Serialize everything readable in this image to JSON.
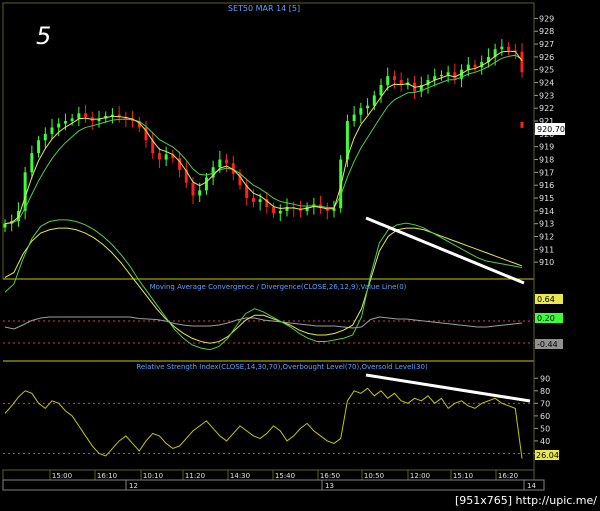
{
  "chart_data": {
    "type": "line",
    "title": "SET50 MAR 14   [5]",
    "annotation_big": "5",
    "watermark": "[951x765] http://upic.me/",
    "colors": {
      "up_candle": "#3cff3c",
      "down_candle": "#ff2020",
      "ma_fast": "#e8e850",
      "ma_slow": "#4ad04a",
      "indicator_line": "#9aa0a0",
      "hline": "#c8c800",
      "dotted_level": "#d04040",
      "axis_text": "#e0e0e0",
      "title_text": "#5aa0ff"
    },
    "price_panel": {
      "ylim": [
        909,
        929.5
      ],
      "yticks": [
        "929",
        "928",
        "927",
        "926",
        "925",
        "924",
        "923",
        "922",
        "921",
        "920",
        "919",
        "918",
        "917",
        "916",
        "915",
        "914",
        "913",
        "912",
        "911",
        "910"
      ],
      "last_price_label": "920.70",
      "last_price": 920.7,
      "closes": [
        913.0,
        913.2,
        914.0,
        917.0,
        918.5,
        919.5,
        920.0,
        920.5,
        920.8,
        921.0,
        921.2,
        921.6,
        921.3,
        921.0,
        921.2,
        921.4,
        921.5,
        921.3,
        921.2,
        921.0,
        920.5,
        919.5,
        918.5,
        918.0,
        918.4,
        918.1,
        917.2,
        916.2,
        915.2,
        915.6,
        916.6,
        917.4,
        918.0,
        917.7,
        916.9,
        916.0,
        915.0,
        914.7,
        914.9,
        914.3,
        913.8,
        914.0,
        914.3,
        914.2,
        914.0,
        914.3,
        914.5,
        914.2,
        914.0,
        914.2,
        918.0,
        921.0,
        921.5,
        922.0,
        922.2,
        923.0,
        923.8,
        924.5,
        924.2,
        923.8,
        924.0,
        923.3,
        923.8,
        924.2,
        924.5,
        924.6,
        924.8,
        924.3,
        925.0,
        925.4,
        925.2,
        925.6,
        926.0,
        926.6,
        926.8,
        926.5,
        926.4,
        924.8
      ]
    },
    "macd_panel": {
      "title": "Moving Average Convergence / Divergence(CLOSE,26,12,9),Value Line(0)",
      "ylim": [
        -0.9,
        0.9
      ],
      "value_labels": [
        "0.64",
        "0.20",
        "-0.44"
      ],
      "macd": [
        -0.1,
        0.0,
        0.3,
        0.55,
        0.7,
        0.76,
        0.78,
        0.78,
        0.76,
        0.72,
        0.66,
        0.58,
        0.48,
        0.36,
        0.22,
        0.05,
        -0.1,
        -0.25,
        -0.4,
        -0.55,
        -0.66,
        -0.74,
        -0.78,
        -0.8,
        -0.76,
        -0.66,
        -0.5,
        -0.36,
        -0.3,
        -0.34,
        -0.4,
        -0.46,
        -0.52,
        -0.6,
        -0.66,
        -0.7,
        -0.7,
        -0.68,
        -0.66,
        -0.62,
        -0.4,
        0.1,
        0.5,
        0.66,
        0.72,
        0.74,
        0.72,
        0.68,
        0.62,
        0.56,
        0.5,
        0.44,
        0.38,
        0.32,
        0.28,
        0.26,
        0.24,
        0.22,
        0.2
      ],
      "signal": [
        0.08,
        0.14,
        0.36,
        0.52,
        0.62,
        0.66,
        0.68,
        0.68,
        0.66,
        0.62,
        0.56,
        0.48,
        0.38,
        0.26,
        0.12,
        -0.02,
        -0.16,
        -0.3,
        -0.42,
        -0.52,
        -0.6,
        -0.66,
        -0.7,
        -0.72,
        -0.7,
        -0.64,
        -0.54,
        -0.44,
        -0.38,
        -0.38,
        -0.42,
        -0.46,
        -0.5,
        -0.56,
        -0.6,
        -0.62,
        -0.62,
        -0.6,
        -0.56,
        -0.5,
        -0.3,
        0.05,
        0.4,
        0.58,
        0.66,
        0.68,
        0.68,
        0.66,
        0.62,
        0.58,
        0.54,
        0.5,
        0.46,
        0.42,
        0.38,
        0.34,
        0.3,
        0.26,
        0.22
      ],
      "hist": [
        -0.1,
        -0.14,
        -0.06,
        0.03,
        0.08,
        0.1,
        0.1,
        0.1,
        0.1,
        0.1,
        0.1,
        0.1,
        0.1,
        0.1,
        0.1,
        0.07,
        0.06,
        0.05,
        0.02,
        -0.03,
        -0.06,
        -0.08,
        -0.08,
        -0.08,
        -0.06,
        -0.02,
        0.04,
        0.08,
        0.08,
        0.04,
        0.02,
        0.0,
        -0.02,
        -0.04,
        -0.06,
        -0.08,
        -0.08,
        -0.08,
        -0.1,
        -0.12,
        -0.1,
        0.05,
        0.1,
        0.08,
        0.06,
        0.06,
        0.04,
        0.02,
        0.0,
        -0.02,
        -0.04,
        -0.06,
        -0.08,
        -0.1,
        -0.1,
        -0.08,
        -0.06,
        -0.04,
        -0.02
      ],
      "dotted_levels": [
        0.2,
        -0.44
      ]
    },
    "rsi_panel": {
      "title": "Relative Strength Index(CLOSE,14,30,70),Overbought Level(70),Oversold Level(30)",
      "ylim": [
        20,
        95
      ],
      "yticks": [
        "90",
        "80",
        "70",
        "60",
        "50",
        "40",
        "30"
      ],
      "last_label": "26.04",
      "overbought": 70,
      "oversold": 30,
      "rsi": [
        62,
        68,
        75,
        80,
        78,
        70,
        66,
        72,
        70,
        64,
        60,
        52,
        44,
        36,
        30,
        28,
        34,
        40,
        44,
        38,
        32,
        40,
        46,
        44,
        38,
        34,
        36,
        42,
        48,
        52,
        56,
        50,
        44,
        40,
        46,
        52,
        48,
        44,
        42,
        46,
        52,
        48,
        40,
        44,
        50,
        54,
        48,
        44,
        40,
        38,
        42,
        72,
        80,
        78,
        82,
        76,
        80,
        74,
        78,
        72,
        70,
        74,
        72,
        76,
        70,
        74,
        66,
        70,
        72,
        68,
        66,
        70,
        72,
        74,
        70,
        68,
        66,
        26
      ]
    },
    "x_axis": {
      "time_labels": [
        "15:00",
        "16:10",
        "10:10",
        "11:20",
        "14:30",
        "15:40",
        "16:50",
        "10:50",
        "12:00",
        "15:10",
        "16:20"
      ],
      "date_labels": [
        "12",
        "13",
        "14"
      ]
    },
    "trend_lines": [
      "bearish divergence trend line on MACD panel",
      "bearish divergence trend line on RSI panel"
    ]
  }
}
